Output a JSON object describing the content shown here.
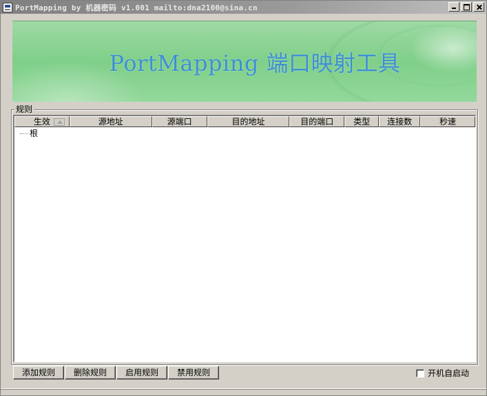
{
  "window": {
    "title": "PortMapping by 机器密码 v1.001 mailto:dna2100@sina.cn"
  },
  "banner": {
    "title": "PortMapping 端口映射工具"
  },
  "rules_group": {
    "label": "规则"
  },
  "table": {
    "columns": [
      "生效",
      "源地址",
      "源端口",
      "目的地址",
      "目的端口",
      "类型",
      "连接数",
      "秒速"
    ],
    "tree_root": "根"
  },
  "buttons": {
    "add": "添加规则",
    "delete": "删除规则",
    "enable": "启用规则",
    "disable": "禁用规则"
  },
  "autostart": {
    "label": "开机自启动",
    "checked": false
  },
  "colors": {
    "banner_text": "#3d8fd4",
    "banner_bg": "#8fd497",
    "titlebar": "#808080"
  }
}
